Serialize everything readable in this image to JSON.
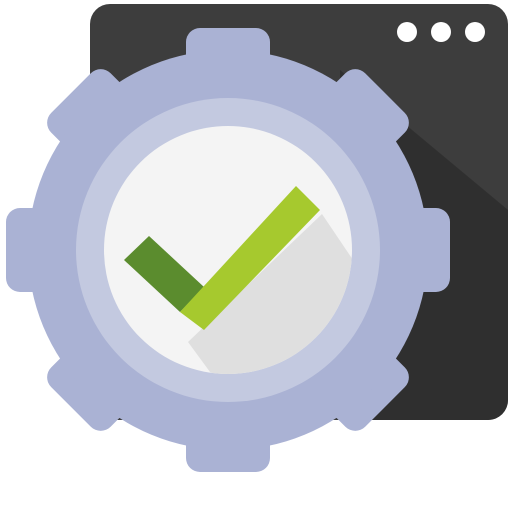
{
  "icon": {
    "name": "settings-check-app-icon",
    "parts": [
      "app-window-icon",
      "window-dots-icon",
      "gear-icon",
      "checkmark-icon"
    ]
  },
  "colors": {
    "window_body": "#3d3d3d",
    "window_shadow": "#2f2f2f",
    "window_dots": "#ffffff",
    "gear_outer": "#aab2d4",
    "gear_ring": "#c3c9e0",
    "gear_center": "#f4f4f4",
    "check_light": "#a6c92e",
    "check_dark": "#5b8c2e",
    "check_shadow": "#dfdfdf"
  }
}
